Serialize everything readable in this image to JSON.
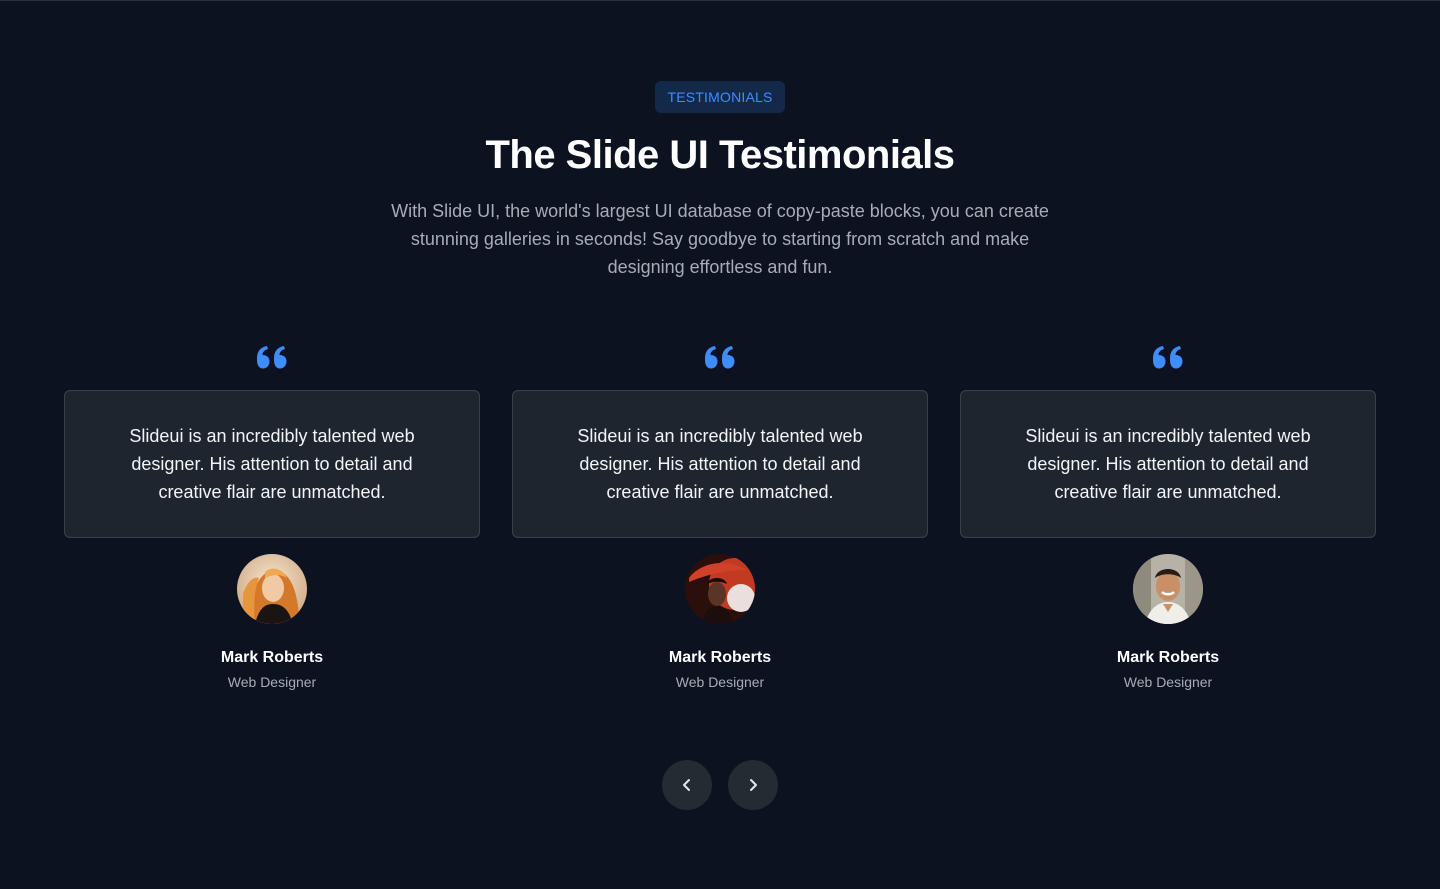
{
  "header": {
    "badge": "TESTIMONIALS",
    "title": "The Slide UI Testimonials",
    "subtitle": "With Slide UI, the world's largest UI database of copy-paste blocks, you can create stunning galleries in seconds! Say goodbye to starting from scratch and make designing effortless and fun."
  },
  "testimonials": [
    {
      "quote": "Slideui is an incredibly talented web designer. His attention to detail and creative flair are unmatched.",
      "name": "Mark Roberts",
      "role": "Web Designer",
      "avatar": "avatar-photo-woman-blonde"
    },
    {
      "quote": "Slideui is an incredibly talented web designer. His attention to detail and creative flair are unmatched.",
      "name": "Mark Roberts",
      "role": "Web Designer",
      "avatar": "avatar-photo-woman-red-hat"
    },
    {
      "quote": "Slideui is an incredibly talented web designer. His attention to detail and creative flair are unmatched.",
      "name": "Mark Roberts",
      "role": "Web Designer",
      "avatar": "avatar-photo-man-smiling"
    }
  ],
  "navigation": {
    "prev_icon": "chevron-left-icon",
    "next_icon": "chevron-right-icon"
  },
  "colors": {
    "background": "#0d1220",
    "accent": "#3f8cff",
    "card": "#1f252e",
    "nav_button": "#252b33"
  }
}
